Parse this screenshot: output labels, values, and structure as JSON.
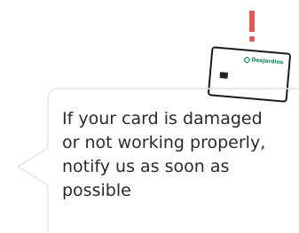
{
  "alert": {
    "icon": "exclamation-icon",
    "color": "#e8585a"
  },
  "card": {
    "brand": "Desjardins",
    "brand_color": "#00874e"
  },
  "message": {
    "lines": [
      "If your card is damaged",
      "or not working properly,",
      "notify us as soon as",
      "possible"
    ]
  }
}
